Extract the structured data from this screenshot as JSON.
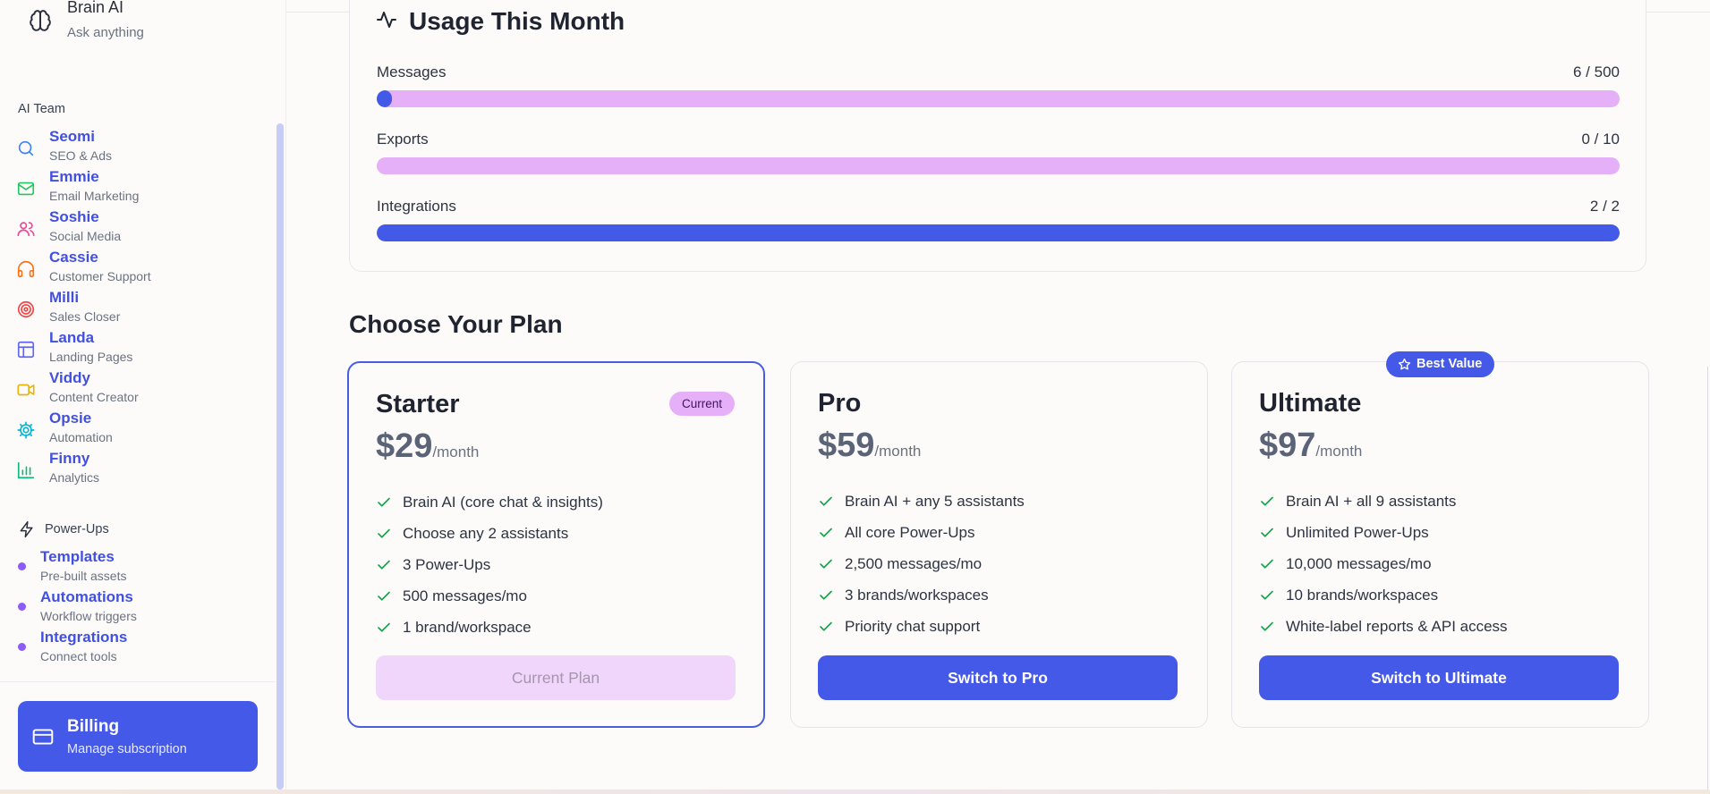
{
  "sidebar": {
    "brand": {
      "name": "Brain AI",
      "subtitle": "Ask anything"
    },
    "team_label": "AI Team",
    "team": [
      {
        "name": "Seomi",
        "role": "SEO & Ads",
        "icon": "search-icon",
        "color": "#3b82f6"
      },
      {
        "name": "Emmie",
        "role": "Email Marketing",
        "icon": "mail-icon",
        "color": "#22c55e"
      },
      {
        "name": "Soshie",
        "role": "Social Media",
        "icon": "users-icon",
        "color": "#ec4899"
      },
      {
        "name": "Cassie",
        "role": "Customer Support",
        "icon": "headphones-icon",
        "color": "#f97316"
      },
      {
        "name": "Milli",
        "role": "Sales Closer",
        "icon": "target-icon",
        "color": "#ef4444"
      },
      {
        "name": "Landa",
        "role": "Landing Pages",
        "icon": "layout-icon",
        "color": "#6366f1"
      },
      {
        "name": "Viddy",
        "role": "Content Creator",
        "icon": "video-icon",
        "color": "#eab308"
      },
      {
        "name": "Opsie",
        "role": "Automation",
        "icon": "gear-icon",
        "color": "#06b6d4"
      },
      {
        "name": "Finny",
        "role": "Analytics",
        "icon": "bar-chart-icon",
        "color": "#10b981"
      }
    ],
    "powerups_label": "Power-Ups",
    "powerups": [
      {
        "name": "Templates",
        "desc": "Pre-built assets"
      },
      {
        "name": "Automations",
        "desc": "Workflow triggers"
      },
      {
        "name": "Integrations",
        "desc": "Connect tools"
      }
    ],
    "billing": {
      "title": "Billing",
      "subtitle": "Manage subscription"
    }
  },
  "usage": {
    "title": "Usage This Month",
    "meters": [
      {
        "label": "Messages",
        "value": "6 / 500",
        "fraction": 0.012
      },
      {
        "label": "Exports",
        "value": "0 / 10",
        "fraction": 0
      },
      {
        "label": "Integrations",
        "value": "2 / 2",
        "fraction": 1
      }
    ]
  },
  "plans": {
    "heading": "Choose Your Plan",
    "best_value_label": "Best Value",
    "items": [
      {
        "name": "Starter",
        "price": "$29",
        "period": "/month",
        "badge": "Current",
        "features": [
          "Brain AI (core chat & insights)",
          "Choose any 2 assistants",
          "3 Power-Ups",
          "500 messages/mo",
          "1 brand/workspace"
        ],
        "button": "Current Plan"
      },
      {
        "name": "Pro",
        "price": "$59",
        "period": "/month",
        "features": [
          "Brain AI + any 5 assistants",
          "All core Power-Ups",
          "2,500 messages/mo",
          "3 brands/workspaces",
          "Priority chat support"
        ],
        "button": "Switch to Pro"
      },
      {
        "name": "Ultimate",
        "price": "$97",
        "period": "/month",
        "features": [
          "Brain AI + all 9 assistants",
          "Unlimited Power-Ups",
          "10,000 messages/mo",
          "10 brands/workspaces",
          "White-label reports & API access"
        ],
        "button": "Switch to Ultimate"
      }
    ]
  },
  "colors": {
    "accent": "#4559e8",
    "accent_text": "#4150e0",
    "meter_track": "#e6b0f8",
    "check": "#16a34a"
  }
}
